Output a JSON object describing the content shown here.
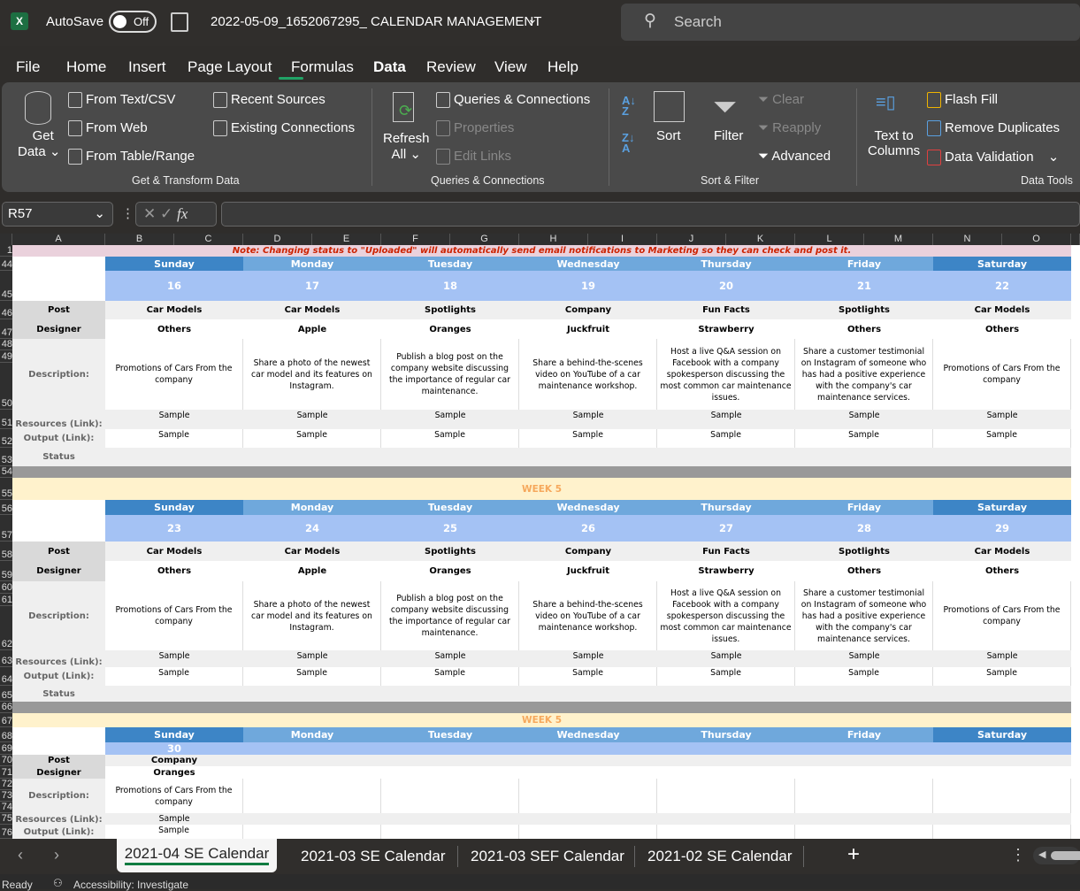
{
  "titlebar": {
    "autosave_label": "AutoSave",
    "autosave_state": "Off",
    "filename": "2022-05-09_1652067295_ CALENDAR MANAGEMENT",
    "search_placeholder": "Search"
  },
  "menu": [
    "File",
    "Home",
    "Insert",
    "Page Layout",
    "Formulas",
    "Data",
    "Review",
    "View",
    "Help"
  ],
  "active_menu": "Data",
  "ribbon": {
    "get_data": [
      "Get",
      "Data"
    ],
    "from_text": "From Text/CSV",
    "from_web": "From Web",
    "from_table": "From Table/Range",
    "recent_sources": "Recent Sources",
    "existing_connections": "Existing Connections",
    "group_get": "Get & Transform Data",
    "refresh": [
      "Refresh",
      "All"
    ],
    "queries_connections": "Queries & Connections",
    "properties": "Properties",
    "edit_links": "Edit Links",
    "group_queries": "Queries & Connections",
    "sort": "Sort",
    "filter": "Filter",
    "clear": "Clear",
    "reapply": "Reapply",
    "advanced": "Advanced",
    "group_sort": "Sort & Filter",
    "text_to_columns": [
      "Text to",
      "Columns"
    ],
    "flash_fill": "Flash Fill",
    "remove_duplicates": "Remove Duplicates",
    "data_validation": "Data Validation",
    "group_tools": "Data Tools"
  },
  "formula_bar": {
    "name_box": "R57",
    "fx": "fx",
    "value": ""
  },
  "columns": [
    "A",
    "B",
    "C",
    "D",
    "E",
    "F",
    "G",
    "H",
    "I",
    "J",
    "K",
    "L",
    "M",
    "N",
    "O"
  ],
  "note": "Note: Changing status to \"Uploaded\" will automatically send email notifications to Marketing so they can check and post it.",
  "row_labels": {
    "post": "Post",
    "designer": "Designer",
    "description": "Description:",
    "resources": "Resources (Link):",
    "output": "Output (Link):",
    "status": "Status"
  },
  "row_numbers": [
    "1",
    "44",
    "45",
    "46",
    "47",
    "48",
    "49",
    "50",
    "51",
    "52",
    "53",
    "54",
    "55",
    "56",
    "57",
    "58",
    "59",
    "60",
    "61",
    "62",
    "63",
    "64",
    "65",
    "66",
    "67",
    "68",
    "69",
    "70",
    "71",
    "72",
    "73",
    "74",
    "75",
    "76"
  ],
  "days": [
    "Sunday",
    "Monday",
    "Tuesday",
    "Wednesday",
    "Thursday",
    "Friday",
    "Saturday"
  ],
  "week_label": "WEEK 5",
  "weeks": [
    {
      "dates": [
        "16",
        "17",
        "18",
        "19",
        "20",
        "21",
        "22"
      ],
      "posts": [
        "Car Models",
        "Car Models",
        "Spotlights",
        "Company",
        "Fun Facts",
        "Spotlights",
        "Car Models"
      ],
      "designers": [
        "Others",
        "Apple",
        "Oranges",
        "Juckfruit",
        "Strawberry",
        "Others",
        "Others"
      ],
      "descriptions": [
        "Promotions of Cars From the company",
        "Share a photo of the newest car model and its features on Instagram.",
        "Publish a blog post on the company website discussing the importance of regular car maintenance.",
        "Share a behind-the-scenes video on YouTube of a car maintenance workshop.",
        "Host a live Q&A session on Facebook with a company spokesperson discussing the most common car maintenance issues.",
        "Share a customer testimonial on Instagram of someone who has had a positive experience with the company's car maintenance services.",
        "Promotions of Cars From the company"
      ],
      "resources": [
        "Sample",
        "Sample",
        "Sample",
        "Sample",
        "Sample",
        "Sample",
        "Sample"
      ],
      "outputs": [
        "Sample",
        "Sample",
        "Sample",
        "Sample",
        "Sample",
        "Sample",
        "Sample"
      ]
    },
    {
      "dates": [
        "23",
        "24",
        "25",
        "26",
        "27",
        "28",
        "29"
      ],
      "posts": [
        "Car Models",
        "Car Models",
        "Spotlights",
        "Company",
        "Fun Facts",
        "Spotlights",
        "Car Models"
      ],
      "designers": [
        "Others",
        "Apple",
        "Oranges",
        "Juckfruit",
        "Strawberry",
        "Others",
        "Others"
      ],
      "descriptions": [
        "Promotions of Cars From the company",
        "Share a photo of the newest car model and its features on Instagram.",
        "Publish a blog post on the company website discussing the importance of regular car maintenance.",
        "Share a behind-the-scenes video on YouTube of a car maintenance workshop.",
        "Host a live Q&A session on Facebook with a company spokesperson discussing the most common car maintenance issues.",
        "Share a customer testimonial on Instagram of someone who has had a positive experience with the company's car maintenance services.",
        "Promotions of Cars From the company"
      ],
      "resources": [
        "Sample",
        "Sample",
        "Sample",
        "Sample",
        "Sample",
        "Sample",
        "Sample"
      ],
      "outputs": [
        "Sample",
        "Sample",
        "Sample",
        "Sample",
        "Sample",
        "Sample",
        "Sample"
      ]
    },
    {
      "dates": [
        "30",
        "",
        "",
        "",
        "",
        "",
        ""
      ],
      "posts": [
        "Company",
        "",
        "",
        "",
        "",
        "",
        ""
      ],
      "designers": [
        "Oranges",
        "",
        "",
        "",
        "",
        "",
        ""
      ],
      "descriptions": [
        "Promotions of Cars From the company",
        "",
        "",
        "",
        "",
        "",
        ""
      ],
      "resources": [
        "Sample",
        "",
        "",
        "",
        "",
        "",
        ""
      ],
      "outputs": [
        "Sample",
        "",
        "",
        "",
        "",
        "",
        ""
      ]
    }
  ],
  "sheet_tabs": [
    "2021-04 SE Calendar",
    "2021-03 SE Calendar",
    "2021-03 SEF Calendar",
    "2021-02 SE Calendar"
  ],
  "active_sheet": "2021-04 SE Calendar",
  "status": {
    "ready": "Ready",
    "accessibility": "Accessibility: Investigate"
  },
  "colors": {
    "weekend_header": "#3d85c6",
    "weekday_header": "#6fa8dc",
    "date_row": "#a4c2f4",
    "note_bg": "#ead1dc",
    "note_text": "#cc2200",
    "week_bg": "#fff2cc",
    "week_text": "#f6a85c",
    "separator": "#999999",
    "accent": "#21a366"
  }
}
